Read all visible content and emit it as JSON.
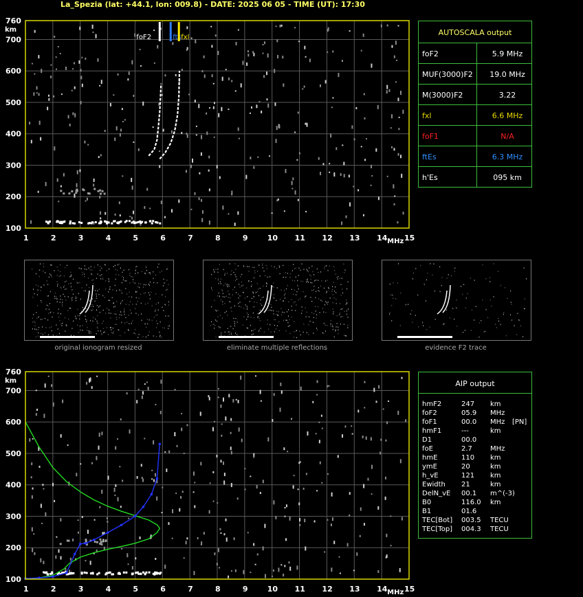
{
  "header": "La_Spezia (lat: +44.1, lon: 009.8) - DATE: 2025 06 05 - TIME (UT): 17:30",
  "colors": {
    "axis": "#d8d800",
    "grid": "#5a5a5a",
    "panel": "#3cbf3c",
    "fof2": "#2f7fff",
    "fxl": "#ffee00",
    "green": "#22dd22",
    "blue": "#2233ff"
  },
  "chart_data": [
    {
      "type": "scatter",
      "name": "ionogram-top",
      "xlabel": "MHz",
      "ylabel": "km",
      "xlim": [
        1,
        15
      ],
      "ylim": [
        100,
        760
      ],
      "x_ticks": [
        1,
        2,
        3,
        4,
        5,
        6,
        7,
        8,
        9,
        10,
        11,
        12,
        13,
        14,
        15
      ],
      "y_ticks": [
        100,
        200,
        300,
        400,
        500,
        600,
        700,
        760
      ],
      "grid": true,
      "markers": [
        {
          "label": "foF2",
          "x": 5.9
        },
        {
          "label": "fts",
          "x": 6.3
        },
        {
          "label": "fxl",
          "x": 6.6
        }
      ],
      "traces": [
        {
          "name": "o-trace",
          "x": [
            5.5,
            5.7,
            5.8,
            5.85,
            5.9,
            5.93,
            5.95
          ],
          "y": [
            330,
            350,
            380,
            420,
            470,
            520,
            560
          ]
        },
        {
          "name": "x-trace",
          "x": [
            5.9,
            6.1,
            6.3,
            6.45,
            6.55,
            6.6,
            6.62
          ],
          "y": [
            320,
            340,
            370,
            410,
            460,
            520,
            600
          ]
        },
        {
          "name": "E-trace",
          "x": [
            1.6,
            2,
            3,
            4,
            5,
            5.9
          ],
          "y": [
            110,
            112,
            114,
            115,
            114,
            112
          ]
        }
      ]
    },
    {
      "type": "line",
      "name": "ionogram-bottom",
      "xlabel": "MHz",
      "ylabel": "km",
      "xlim": [
        1,
        15
      ],
      "ylim": [
        100,
        760
      ],
      "x_ticks": [
        1,
        2,
        3,
        4,
        5,
        6,
        7,
        8,
        9,
        10,
        11,
        12,
        13,
        14,
        15
      ],
      "y_ticks": [
        100,
        200,
        300,
        400,
        500,
        600,
        700,
        760
      ],
      "grid": true,
      "series": [
        {
          "x": [
            1.0,
            1.5,
            2.0,
            2.5,
            3.0,
            3.5,
            4.0,
            4.5,
            5.0,
            5.5,
            5.8,
            5.9,
            5.8,
            5.5,
            5.0,
            4.5,
            4.0,
            3.5,
            3.0,
            2.6,
            2.4,
            2.0,
            1.5,
            1.0
          ],
          "y": [
            600,
            520,
            455,
            410,
            378,
            352,
            332,
            316,
            302,
            288,
            273,
            262,
            248,
            228,
            214,
            204,
            195,
            184,
            170,
            150,
            132,
            112,
            104,
            100
          ]
        },
        {
          "x": [
            1.0,
            1.5,
            2.0,
            2.5,
            2.8,
            3.0,
            3.2,
            3.5,
            4.0,
            4.5,
            5.0,
            5.3,
            5.6,
            5.8,
            5.9
          ],
          "y": [
            102,
            104,
            108,
            120,
            180,
            212,
            214,
            225,
            248,
            272,
            300,
            330,
            370,
            420,
            530
          ]
        }
      ]
    }
  ],
  "autoscala": {
    "title": "AUTOSCALA output",
    "rows": [
      {
        "k": "foF2",
        "v": "5.9 MHz",
        "kc": "#ffffff",
        "vc": "#ffffff"
      },
      {
        "k": "MUF(3000)F2",
        "v": "19.0 MHz",
        "kc": "#ffffff",
        "vc": "#ffffff"
      },
      {
        "k": "M(3000)F2",
        "v": "3.22",
        "kc": "#ffffff",
        "vc": "#ffffff"
      },
      {
        "k": "fxl",
        "v": "6.6 MHz",
        "kc": "#e8d800",
        "vc": "#e8d800"
      },
      {
        "k": "foF1",
        "v": "N/A",
        "kc": "#ff2020",
        "vc": "#ff2020"
      },
      {
        "k": "ftEs",
        "v": "6.3 MHz",
        "kc": "#2f8fff",
        "vc": "#2f8fff"
      },
      {
        "k": "h'Es",
        "v": "095     km",
        "kc": "#ffffff",
        "vc": "#ffffff"
      }
    ]
  },
  "thumbs": [
    {
      "caption": "original ionogram resized"
    },
    {
      "caption": "eliminate multiple reflections"
    },
    {
      "caption": "evidence F2 trace"
    }
  ],
  "aip": {
    "title": "AIP output",
    "rows": [
      {
        "a": "hmF2",
        "b": "247",
        "c": "km",
        "d": ""
      },
      {
        "a": "foF2",
        "b": "05.9",
        "c": "MHz",
        "d": ""
      },
      {
        "a": "foF1",
        "b": "00.0",
        "c": "MHz",
        "d": "[PN]"
      },
      {
        "a": "hmF1",
        "b": "---",
        "c": "km",
        "d": ""
      },
      {
        "a": "D1",
        "b": "00.0",
        "c": "",
        "d": ""
      },
      {
        "a": "foE",
        "b": "2.7",
        "c": "MHz",
        "d": ""
      },
      {
        "a": "hmE",
        "b": "110",
        "c": "km",
        "d": ""
      },
      {
        "a": "ymE",
        "b": "20",
        "c": "km",
        "d": ""
      },
      {
        "a": "h_vE",
        "b": "121",
        "c": "km",
        "d": ""
      },
      {
        "a": "Ewidth",
        "b": "21",
        "c": "km",
        "d": ""
      },
      {
        "a": "DelN_vE",
        "b": "00.1",
        "c": "m^(-3)",
        "d": ""
      },
      {
        "a": "B0",
        "b": "116.0",
        "c": "km",
        "d": ""
      },
      {
        "a": "B1",
        "b": "01.6",
        "c": "",
        "d": ""
      },
      {
        "a": "TEC[Bot]",
        "b": "003.5",
        "c": "TECU",
        "d": ""
      },
      {
        "a": "TEC[Top]",
        "b": "004.3",
        "c": "TECU",
        "d": ""
      }
    ]
  }
}
